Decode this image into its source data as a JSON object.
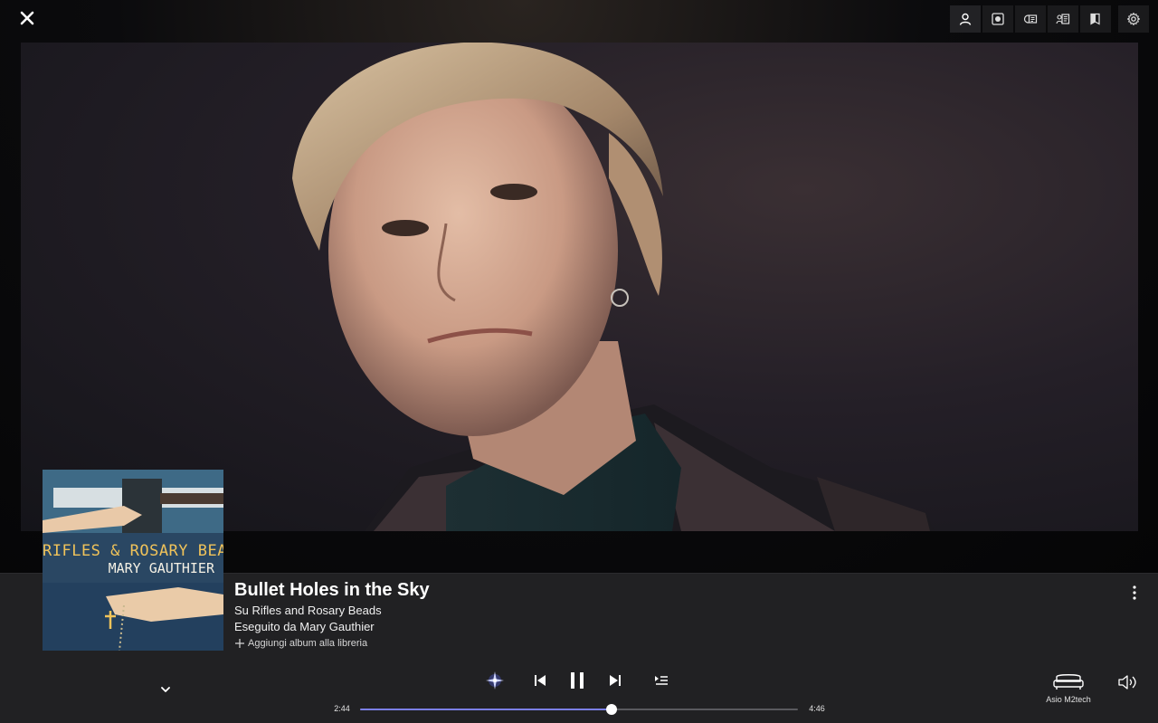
{
  "header": {
    "close_icon": "close-icon",
    "toolbar": [
      {
        "name": "artist-view",
        "icon": "person-icon",
        "active": true
      },
      {
        "name": "album-view",
        "icon": "record-icon",
        "active": false
      },
      {
        "name": "info-view",
        "icon": "info-card-icon",
        "active": false
      },
      {
        "name": "credits-view",
        "icon": "credits-icon",
        "active": false
      },
      {
        "name": "lyrics-view",
        "icon": "book-icon",
        "active": false
      },
      {
        "name": "settings",
        "icon": "gear-icon",
        "active": false
      }
    ]
  },
  "track": {
    "title": "Bullet Holes in the Sky",
    "album_line": "Su Rifles and Rosary Beads",
    "artist_line": "Eseguito da Mary Gauthier",
    "add_album": "Aggiungi album alla libreria"
  },
  "album_art": {
    "line1": "RIFLES & ROSARY BEADS",
    "line2": "MARY GAUTHIER"
  },
  "player": {
    "current_time": "2:44",
    "total_time": "4:46",
    "progress": 0.574,
    "state": "playing"
  },
  "output": {
    "device": "Asio M2tech"
  },
  "colors": {
    "accent": "#7b7fe6",
    "bar_bg": "#212123"
  }
}
